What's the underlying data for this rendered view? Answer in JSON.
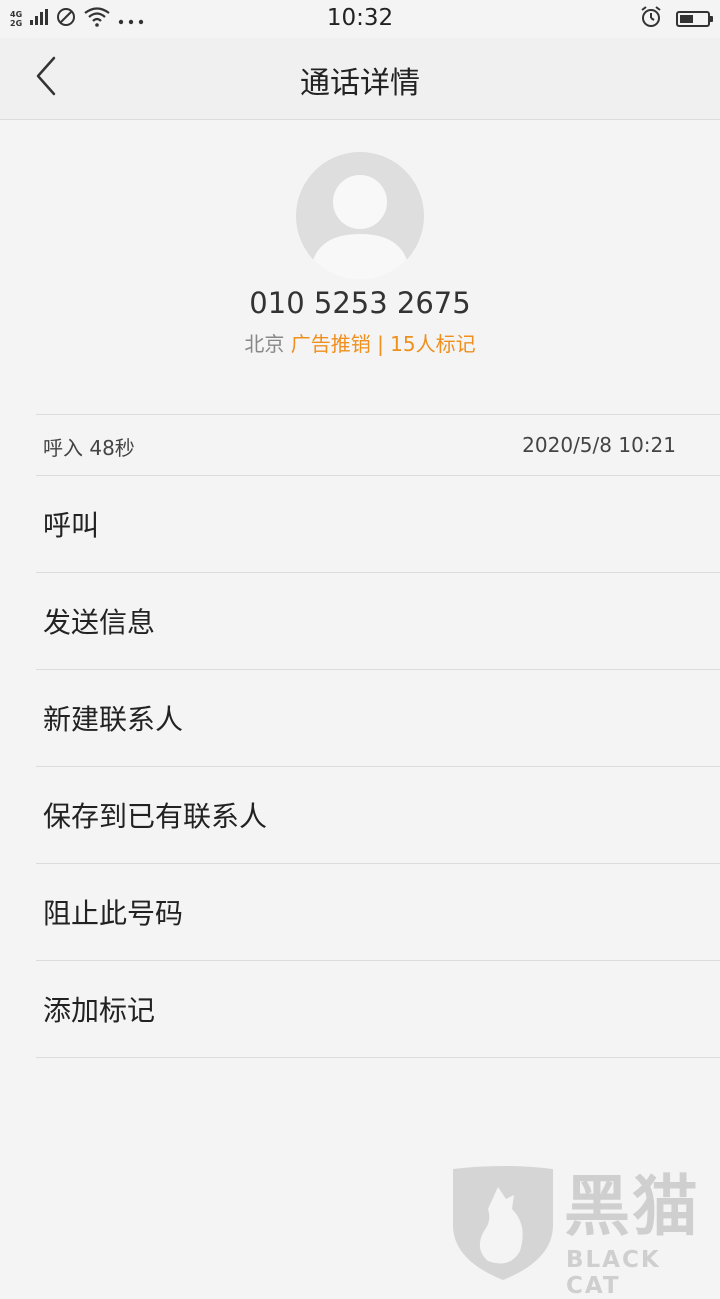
{
  "status_bar": {
    "network_top": "4G",
    "network_bottom": "2G",
    "time": "10:32",
    "battery_level": 0.5,
    "icons": [
      "signal-icon",
      "no-sim-icon",
      "wifi-icon",
      "more-icon",
      "alarm-icon",
      "battery-icon"
    ]
  },
  "header": {
    "title": "通话详情",
    "back_icon": "back-chevron-icon"
  },
  "contact": {
    "avatar_icon": "default-avatar-icon",
    "number": "010 5253 2675",
    "city": "北京",
    "tag": "广告推销 | 15人标记"
  },
  "call_log": {
    "type_duration": "呼入  48秒",
    "datetime": "2020/5/8 10:21"
  },
  "actions": [
    {
      "label": "呼叫"
    },
    {
      "label": "发送信息"
    },
    {
      "label": "新建联系人"
    },
    {
      "label": "保存到已有联系人"
    },
    {
      "label": "阻止此号码"
    },
    {
      "label": "添加标记"
    }
  ],
  "watermark": {
    "cn": "黑猫",
    "en": "BLACK CAT"
  },
  "colors": {
    "accent": "#ef8f1d",
    "background": "#f4f4f4",
    "divider": "#dcdcdc"
  }
}
